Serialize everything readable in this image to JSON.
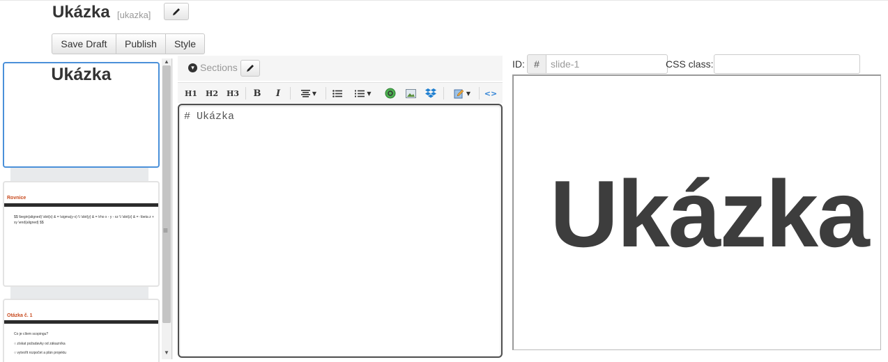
{
  "header": {
    "title": "Ukázka",
    "slug": "[ukazka]",
    "buttons": {
      "save_draft": "Save Draft",
      "publish": "Publish",
      "style": "Style"
    }
  },
  "slides": [
    {
      "title": "Ukázka"
    },
    {
      "heading": "Rovnice",
      "body": "$$ \\begin{aligned} \\dot{x} & = \\sigma(y-x) \\\\ \\dot{y} & = \\rho x - y - xz \\\\ \\dot{z} & = -\\beta z + xy \\end{aligned} $$"
    },
    {
      "heading": "Otázka č. 1",
      "lines": [
        "Co je cílem scopingu?",
        "○ získat požadavky od zákazníka",
        "○ vytvořit rozpočet a plán projektu"
      ]
    }
  ],
  "editor": {
    "sections_label": "Sections",
    "toolbar": {
      "h1": "H1",
      "h2": "H2",
      "h3": "H3",
      "bold": "B",
      "italic": "I"
    },
    "content": "# Ukázka"
  },
  "slide_props": {
    "id_label": "ID:",
    "id_prefix": "#",
    "id_placeholder": "slide-1",
    "css_label": "CSS class:",
    "css_value": ""
  },
  "preview": {
    "title": "Ukázka"
  },
  "colors": {
    "active_border": "#4a90d9",
    "thumb_heading": "#c84a1e"
  }
}
